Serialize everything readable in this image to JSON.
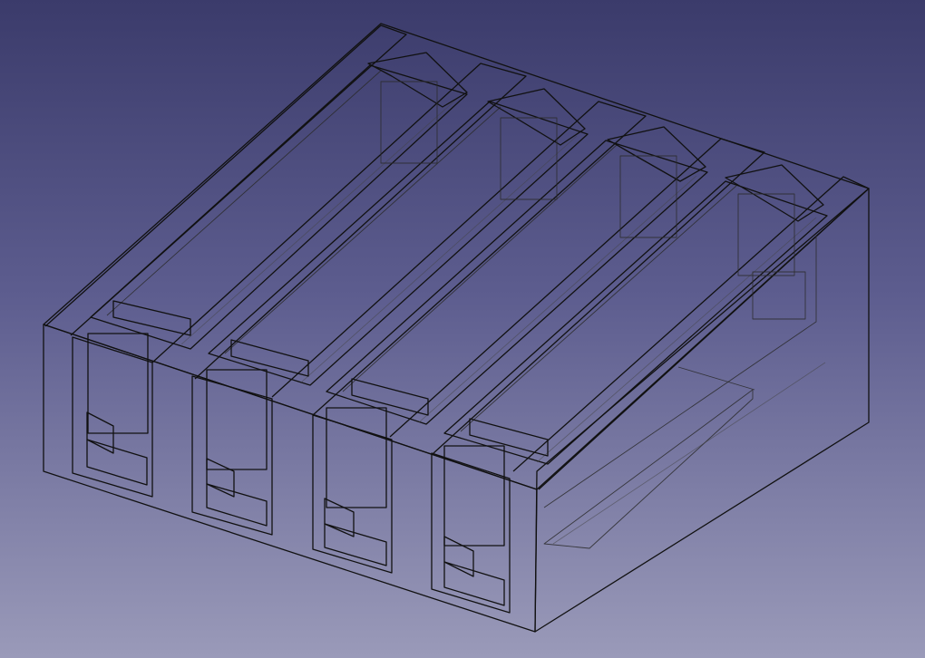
{
  "viewer": {
    "background_top": "#3b3b6b",
    "background_bottom": "#9a9ab9",
    "body_fill": "#9a9aa0",
    "body_fill_opacity": 0.55,
    "edge_color": "#111111"
  },
  "model": {
    "description_icon": "transparent-box-icon",
    "slot_count": 4
  }
}
